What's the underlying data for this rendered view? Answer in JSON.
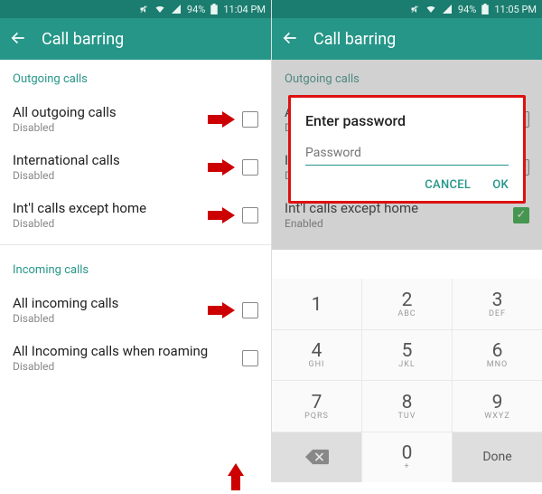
{
  "left": {
    "status": {
      "time": "11:04 PM",
      "battery": "94%"
    },
    "header": {
      "title": "Call barring"
    },
    "sections": {
      "outgoing_label": "Outgoing calls",
      "incoming_label": "Incoming calls"
    },
    "rows": {
      "all_outgoing": {
        "label": "All outgoing calls",
        "sub": "Disabled"
      },
      "international": {
        "label": "International calls",
        "sub": "Disabled"
      },
      "intl_except_home": {
        "label": "Int'l calls except home",
        "sub": "Disabled"
      },
      "all_incoming": {
        "label": "All incoming calls",
        "sub": "Disabled"
      },
      "incoming_roaming": {
        "label": "All Incoming calls when roaming",
        "sub": "Disabled"
      }
    }
  },
  "right": {
    "status": {
      "time": "11:05 PM",
      "battery": "94%"
    },
    "header": {
      "title": "Call barring"
    },
    "sections": {
      "outgoing_label": "Outgoing calls"
    },
    "rows": {
      "all_outgoing": {
        "label": "Al",
        "sub": "Di"
      },
      "international": {
        "label": "In",
        "sub": "Di"
      },
      "intl_except_home": {
        "label": "Int'l calls except home",
        "sub": "Enabled"
      }
    },
    "dialog": {
      "title": "Enter password",
      "placeholder": "Password",
      "cancel": "CANCEL",
      "ok": "OK"
    },
    "keypad": {
      "k1": {
        "d": "1",
        "l": ""
      },
      "k2": {
        "d": "2",
        "l": "ABC"
      },
      "k3": {
        "d": "3",
        "l": "DEF"
      },
      "k4": {
        "d": "4",
        "l": "GHI"
      },
      "k5": {
        "d": "5",
        "l": "JKL"
      },
      "k6": {
        "d": "6",
        "l": "MNO"
      },
      "k7": {
        "d": "7",
        "l": "PQRS"
      },
      "k8": {
        "d": "8",
        "l": "TUV"
      },
      "k9": {
        "d": "9",
        "l": "WXYZ"
      },
      "k0": {
        "d": "0",
        "l": "+"
      },
      "done": "Done"
    }
  }
}
